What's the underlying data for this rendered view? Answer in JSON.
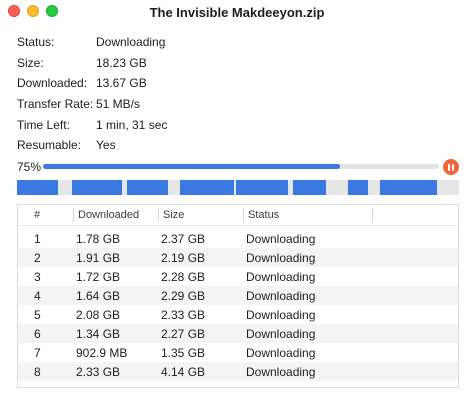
{
  "window": {
    "title": "The Invisible Makdeeyon.zip"
  },
  "info": [
    {
      "label": "Status:",
      "value": "Downloading"
    },
    {
      "label": "Size:",
      "value": "18.23 GB"
    },
    {
      "label": "Downloaded:",
      "value": "13.67 GB"
    },
    {
      "label": "Transfer Rate:",
      "value": "51 MB/s"
    },
    {
      "label": "Time Left:",
      "value": "1 min, 31 sec"
    },
    {
      "label": "Resumable:",
      "value": "Yes"
    }
  ],
  "progress": {
    "label": "75%",
    "fraction": 0.75
  },
  "colors": {
    "accent": "#3a7ae0",
    "pause": "#f0653c"
  },
  "table": {
    "columns": [
      "#",
      "Downloaded",
      "Size",
      "Status"
    ],
    "rows": [
      {
        "n": "1",
        "downloaded": "1.78 GB",
        "size": "2.37 GB",
        "status": "Downloading"
      },
      {
        "n": "2",
        "downloaded": "1.91 GB",
        "size": "2.19 GB",
        "status": "Downloading"
      },
      {
        "n": "3",
        "downloaded": "1.72 GB",
        "size": "2.28 GB",
        "status": "Downloading"
      },
      {
        "n": "4",
        "downloaded": "1.64 GB",
        "size": "2.29 GB",
        "status": "Downloading"
      },
      {
        "n": "5",
        "downloaded": "2.08 GB",
        "size": "2.33 GB",
        "status": "Downloading"
      },
      {
        "n": "6",
        "downloaded": "1.34 GB",
        "size": "2.27 GB",
        "status": "Downloading"
      },
      {
        "n": "7",
        "downloaded": "902.9 MB",
        "size": "1.35 GB",
        "status": "Downloading"
      },
      {
        "n": "8",
        "downloaded": "2.33 GB",
        "size": "4.14 GB",
        "status": "Downloading"
      }
    ]
  }
}
